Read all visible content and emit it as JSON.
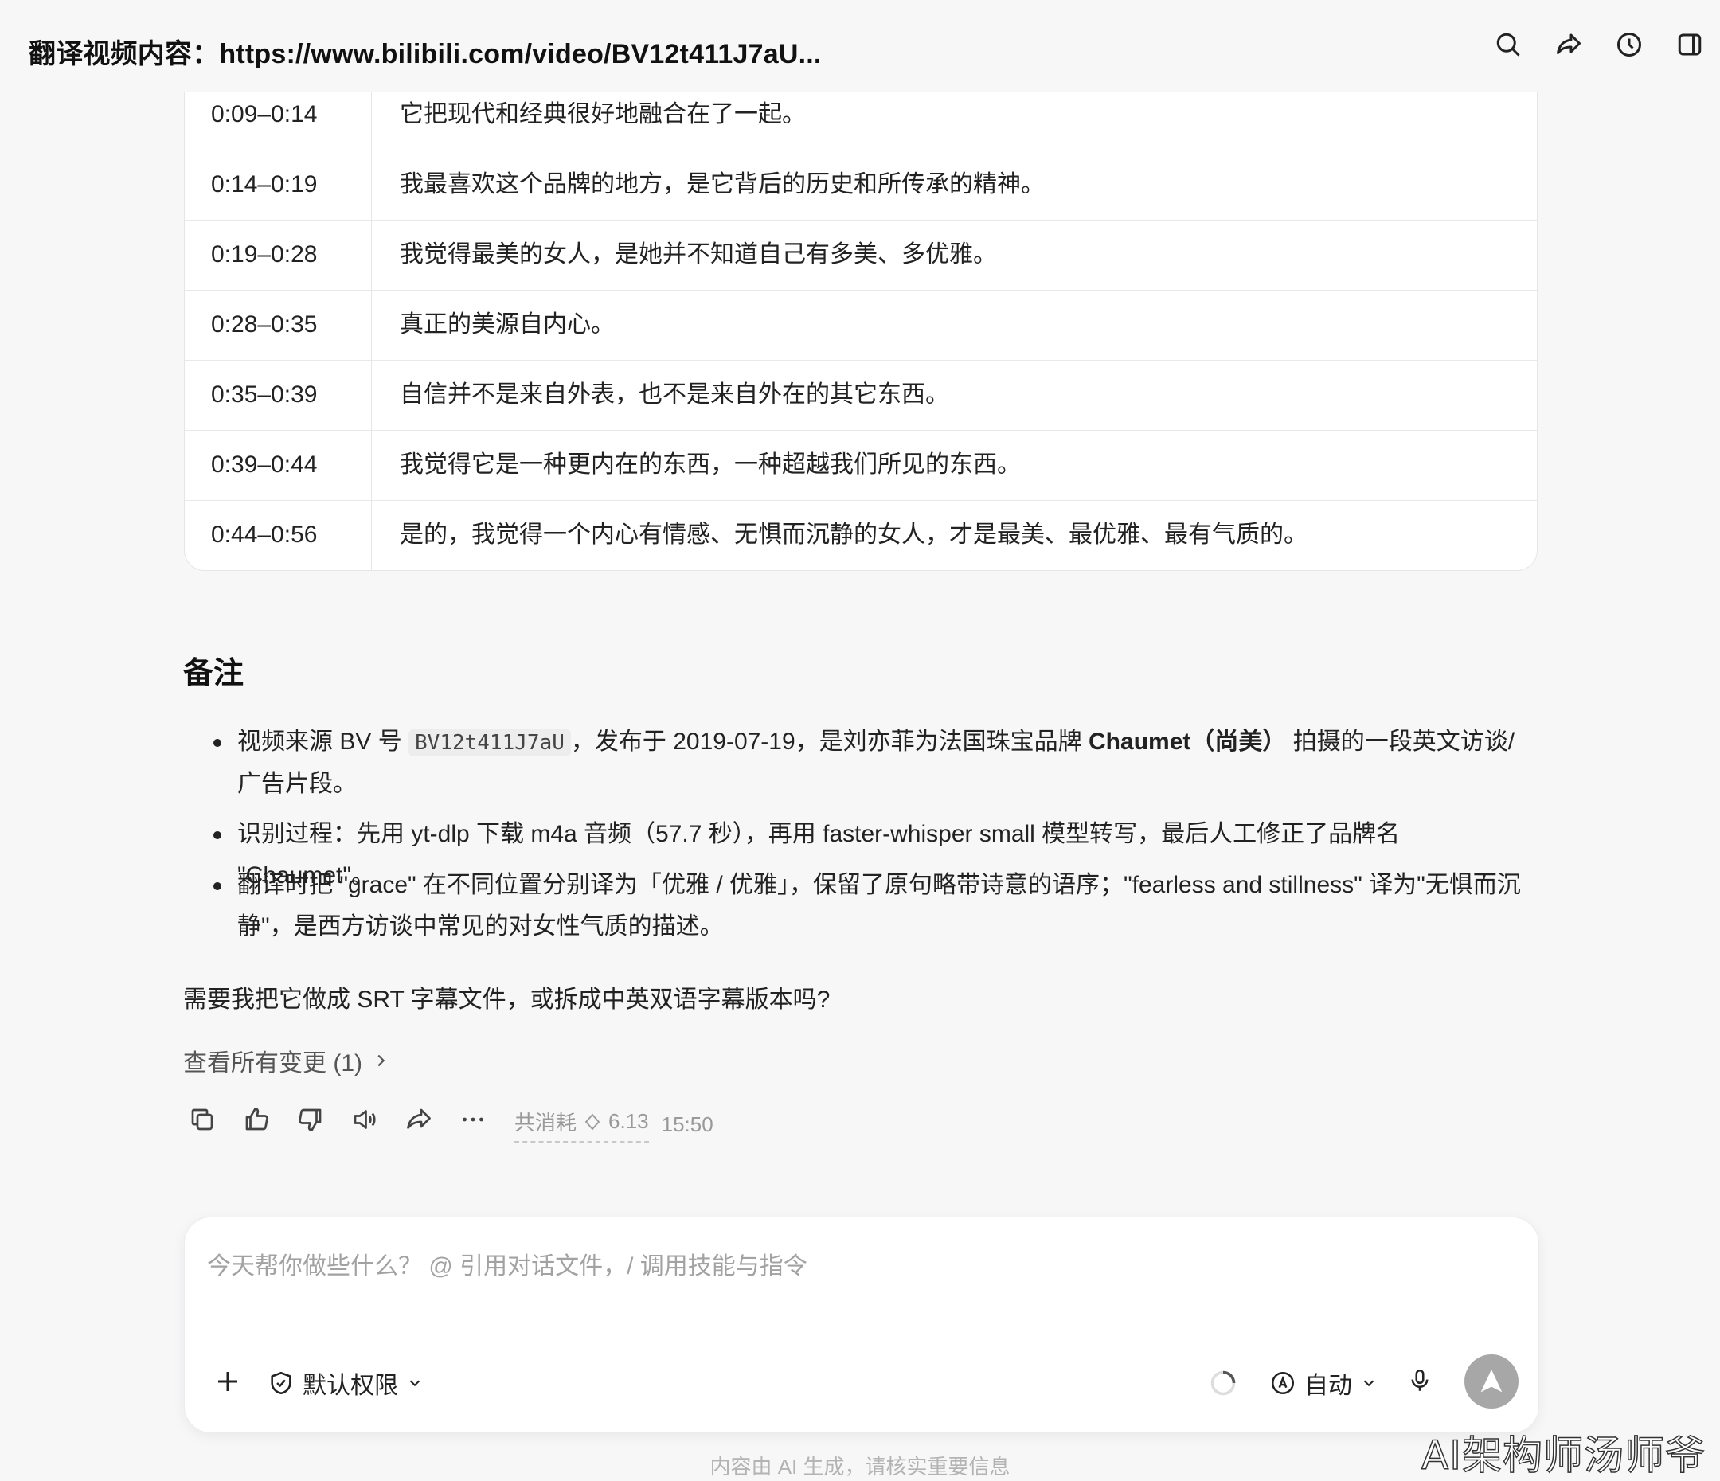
{
  "header": {
    "title": "翻译视频内容：https://www.bilibili.com/video/BV12t411J7aU...",
    "icons": [
      "search-icon",
      "share-icon",
      "history-icon",
      "panel-icon"
    ]
  },
  "table": {
    "rows": [
      {
        "time": "0:09–0:14",
        "text": "它把现代和经典很好地融合在了一起。"
      },
      {
        "time": "0:14–0:19",
        "text": "我最喜欢这个品牌的地方，是它背后的历史和所传承的精神。"
      },
      {
        "time": "0:19–0:28",
        "text": "我觉得最美的女人，是她并不知道自己有多美、多优雅。"
      },
      {
        "time": "0:28–0:35",
        "text": "真正的美源自内心。"
      },
      {
        "time": "0:35–0:39",
        "text": "自信并不是来自外表，也不是来自外在的其它东西。"
      },
      {
        "time": "0:39–0:44",
        "text": "我觉得它是一种更内在的东西，一种超越我们所见的东西。"
      },
      {
        "time": "0:44–0:56",
        "text": "是的，我觉得一个内心有情感、无惧而沉静的女人，才是最美、最优雅、最有气质的。"
      }
    ]
  },
  "notes": {
    "heading": "备注",
    "b1_pre": "视频来源 BV 号 ",
    "b1_code": "BV12t411J7aU",
    "b1_mid": "，发布于 2019-07-19，是刘亦菲为法国珠宝品牌 ",
    "b1_bold": "Chaumet（尚美）",
    "b1_post": " 拍摄的一段英文访谈/广告片段。",
    "b2": "识别过程：先用 yt-dlp 下载 m4a 音频（57.7 秒），再用 faster-whisper small 模型转写，最后人工修正了品牌名 \"Chaumet\"。",
    "b3": "翻译时把 \"grace\" 在不同位置分别译为「优雅 / 优雅」，保留了原句略带诗意的语序；\"fearless and stillness\" 译为\"无惧而沉静\"，是西方访谈中常见的对女性气质的描述。"
  },
  "question": "需要我把它做成 SRT 字幕文件，或拆成中英双语字幕版本吗?",
  "changes_label": "查看所有变更 (1)",
  "meta": {
    "cost_label": "共消耗",
    "cost_value": "6.13",
    "time": "15:50"
  },
  "composer": {
    "placeholder": "今天帮你做些什么？ @ 引用对话文件，/ 调用技能与指令",
    "permission_label": "默认权限",
    "mode_label": "自动"
  },
  "footer_note": "内容由 AI 生成，请核实重要信息",
  "watermark": "AI架构师汤师爷"
}
